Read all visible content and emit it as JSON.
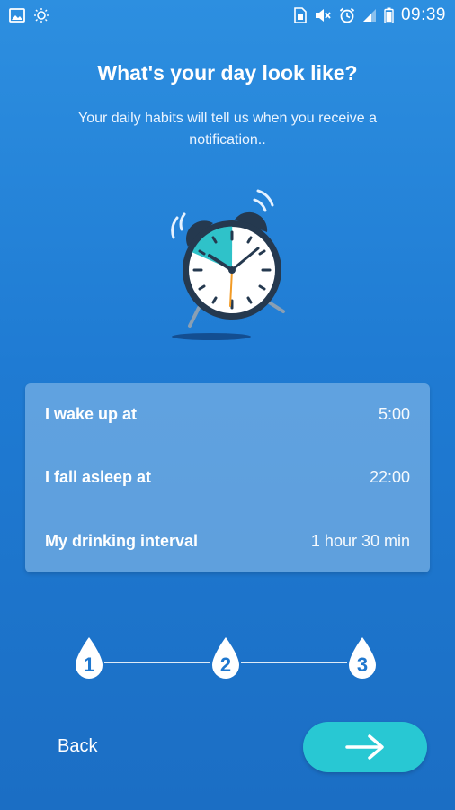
{
  "status_bar": {
    "left_icons": [
      "image-icon",
      "brightness-icon"
    ],
    "right_icons": [
      "sim-icon",
      "mute-icon",
      "alarm-icon",
      "signal-icon",
      "battery-icon"
    ],
    "time": "09:39"
  },
  "header": {
    "title": "What's your day look like?",
    "subtitle": "Your daily habits will tell us when you receive a notification.."
  },
  "illustration": {
    "icon": "alarm-clock-icon"
  },
  "settings": {
    "rows": [
      {
        "label": "I wake up at",
        "value": "5:00"
      },
      {
        "label": "I fall asleep at",
        "value": "22:00"
      },
      {
        "label": "My drinking interval",
        "value": "1 hour 30 min"
      }
    ]
  },
  "stepper": {
    "steps": [
      "1",
      "2",
      "3"
    ],
    "icon": "water-drop-icon"
  },
  "footer": {
    "back_label": "Back",
    "next_icon": "arrow-right-icon"
  },
  "colors": {
    "background_top": "#2d8fe0",
    "background_bottom": "#1b6ec4",
    "accent": "#28c8d3",
    "step_number": "#1f78cf"
  }
}
